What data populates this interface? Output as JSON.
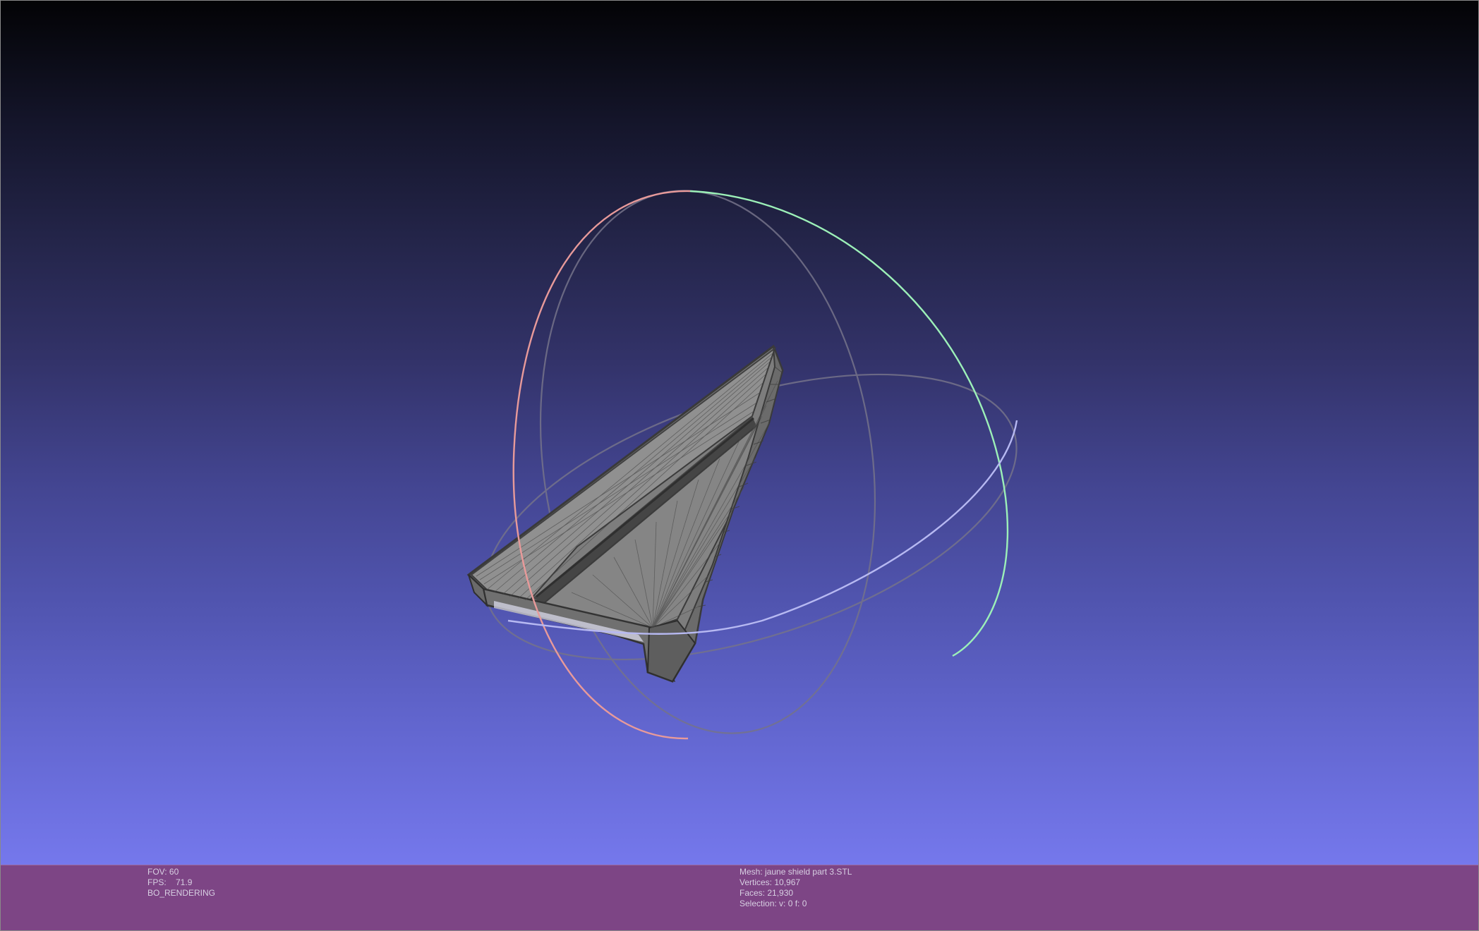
{
  "viewer": {
    "background_top": "#030305",
    "background_bottom": "#7578ec",
    "mesh_color": "#8f8f8f",
    "arcball_colors": {
      "x_ring": "#e89a9a",
      "y_ring": "#9cf0b8",
      "z_ring": "#b7b9f2",
      "ring_faded": "#75738a"
    }
  },
  "info_bar": {
    "background": "#7d4585",
    "left": {
      "fov": "FOV: 60",
      "fps": "FPS:    71.9",
      "mode": "BO_RENDERING"
    },
    "right": {
      "mesh": "Mesh: jaune shield part 3.STL",
      "vertices": "Vertices: 10,967",
      "faces": "Faces: 21,930",
      "selection": "Selection: v: 0 f: 0"
    }
  }
}
